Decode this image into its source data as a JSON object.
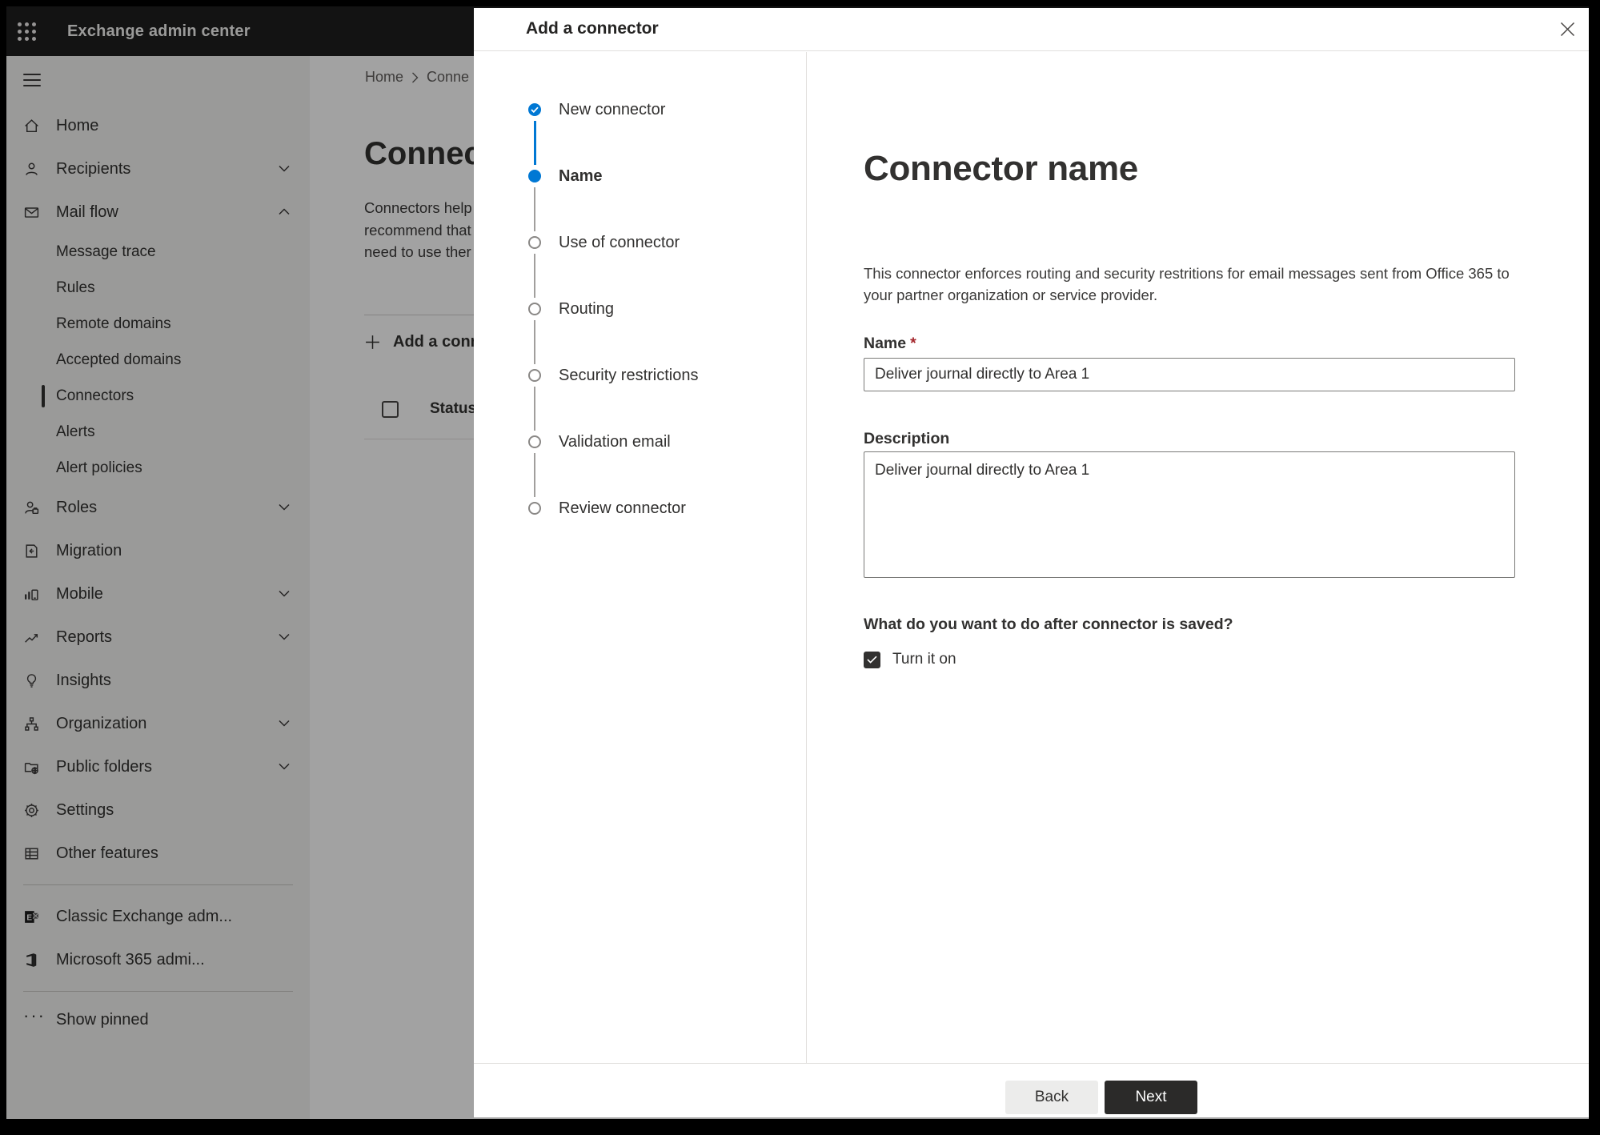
{
  "topbar": {
    "title": "Exchange admin center"
  },
  "sidebar": {
    "items": [
      {
        "label": "Home",
        "icon": "home-icon"
      },
      {
        "label": "Recipients",
        "icon": "person-icon",
        "chevron": "down"
      },
      {
        "label": "Mail flow",
        "icon": "mail-icon",
        "chevron": "up",
        "expanded": true
      },
      {
        "label": "Message trace",
        "type": "sub"
      },
      {
        "label": "Rules",
        "type": "sub"
      },
      {
        "label": "Remote domains",
        "type": "sub"
      },
      {
        "label": "Accepted domains",
        "type": "sub"
      },
      {
        "label": "Connectors",
        "type": "sub",
        "selected": true
      },
      {
        "label": "Alerts",
        "type": "sub"
      },
      {
        "label": "Alert policies",
        "type": "sub"
      },
      {
        "label": "Roles",
        "icon": "person-badge-icon",
        "chevron": "down"
      },
      {
        "label": "Migration",
        "icon": "migration-icon"
      },
      {
        "label": "Mobile",
        "icon": "mobile-icon",
        "chevron": "down"
      },
      {
        "label": "Reports",
        "icon": "reports-icon",
        "chevron": "down"
      },
      {
        "label": "Insights",
        "icon": "lightbulb-icon"
      },
      {
        "label": "Organization",
        "icon": "org-icon",
        "chevron": "down"
      },
      {
        "label": "Public folders",
        "icon": "folder-globe-icon",
        "chevron": "down"
      },
      {
        "label": "Settings",
        "icon": "gear-icon"
      },
      {
        "label": "Other features",
        "icon": "grid-icon"
      }
    ],
    "footer_items": [
      {
        "label": "Classic Exchange adm...",
        "icon": "exchange-logo-icon"
      },
      {
        "label": "Microsoft 365 admi...",
        "icon": "m365-logo-icon"
      }
    ],
    "show_pinned": "Show pinned"
  },
  "page": {
    "breadcrumb": {
      "home": "Home",
      "current": "Conne"
    },
    "title": "Connec",
    "intro_lines": [
      "Connectors help",
      "recommend that",
      "need to use ther"
    ],
    "add_button": "Add a conn",
    "table": {
      "status_header": "Status"
    }
  },
  "dialog": {
    "title": "Add a connector",
    "steps": [
      {
        "label": "New connector",
        "state": "completed"
      },
      {
        "label": "Name",
        "state": "current"
      },
      {
        "label": "Use of connector",
        "state": "upcoming"
      },
      {
        "label": "Routing",
        "state": "upcoming"
      },
      {
        "label": "Security restrictions",
        "state": "upcoming"
      },
      {
        "label": "Validation email",
        "state": "upcoming"
      },
      {
        "label": "Review connector",
        "state": "upcoming"
      }
    ],
    "heading": "Connector name",
    "description": "This connector enforces routing and security restritions for email messages sent from Office 365 to your partner organization or service provider.",
    "name_label": "Name",
    "required_mark": "*",
    "name_value": "Deliver journal directly to Area 1",
    "description_label": "Description",
    "description_value": "Deliver journal directly to Area 1",
    "after_save_question": "What do you want to do after connector is saved?",
    "turn_on": {
      "label": "Turn it on",
      "checked": true
    },
    "footer": {
      "back": "Back",
      "next": "Next"
    }
  },
  "colors": {
    "accent": "#0078d4",
    "topbar_bg": "#1f1f1f",
    "sidebar_bg": "#f3f2f1",
    "overlay": "rgba(0,0,0,0.365)",
    "text": "#323130",
    "field_border": "#7a7a78",
    "divider": "#e1dfdd",
    "danger": "#a4262c",
    "next_button_bg": "#2b2a29",
    "back_button_bg": "#ececeb"
  }
}
